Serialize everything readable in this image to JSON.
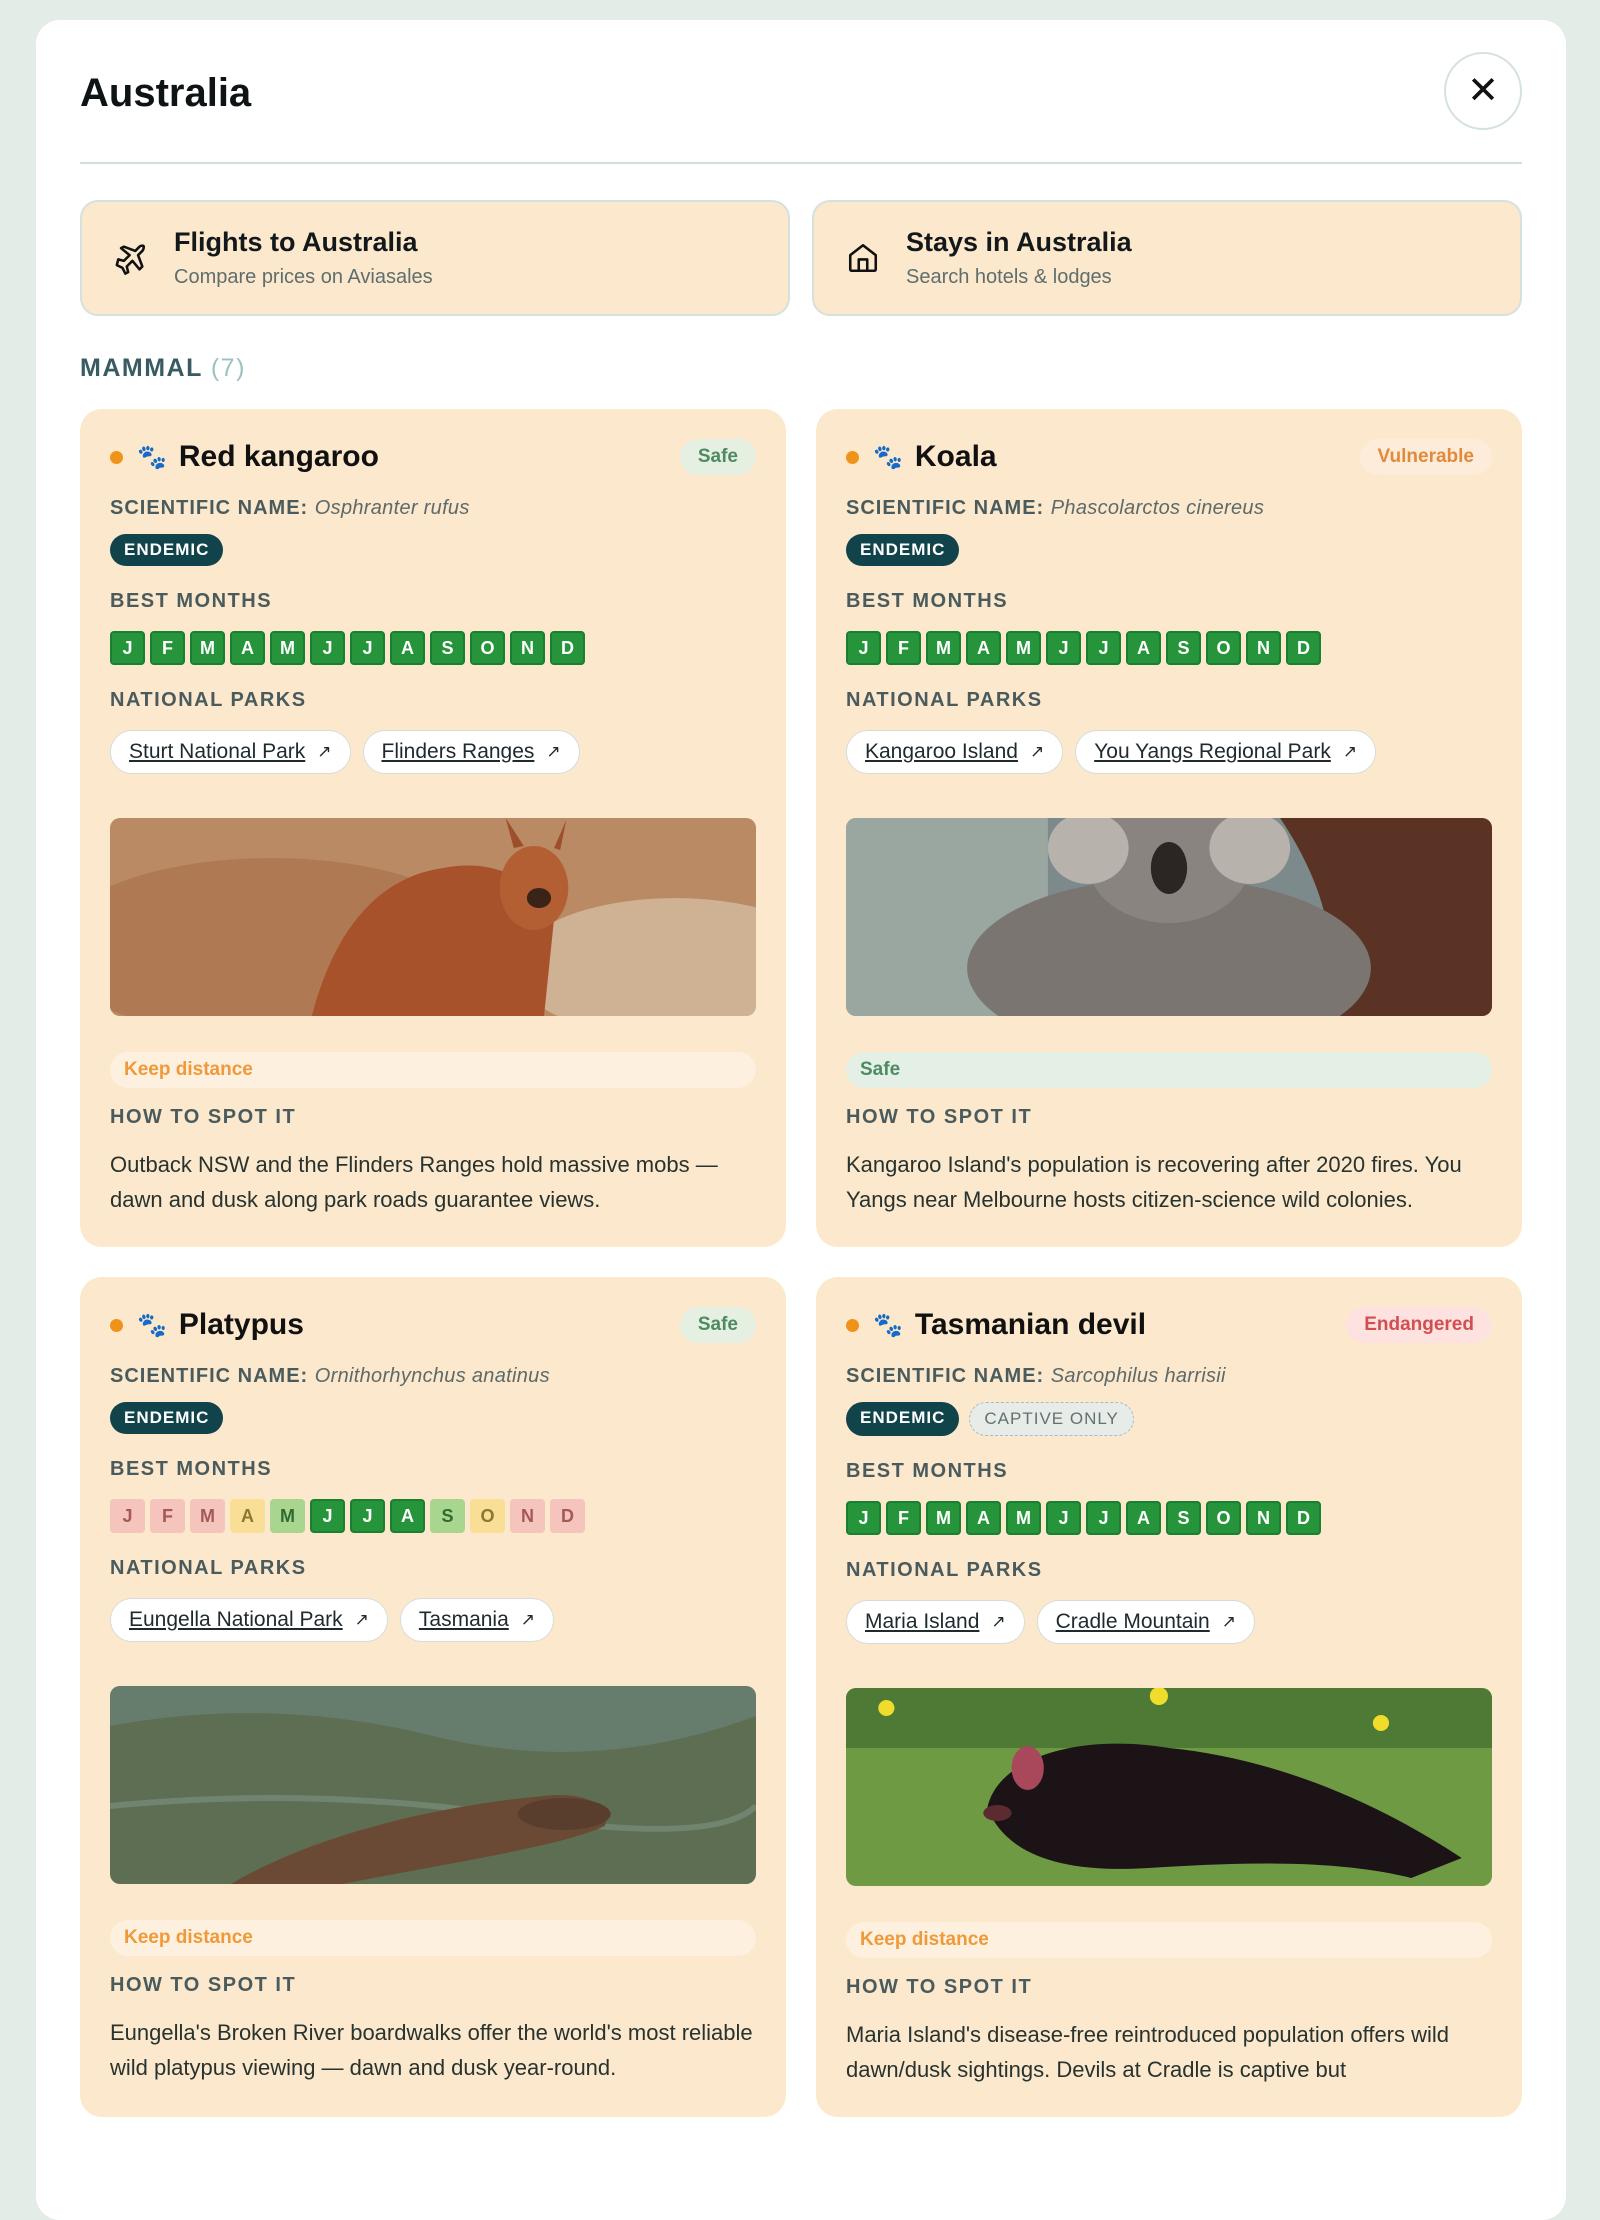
{
  "header": {
    "title": "Australia"
  },
  "cta": {
    "flights": {
      "title": "Flights to Australia",
      "subtitle": "Compare prices on Aviasales"
    },
    "stays": {
      "title": "Stays in Australia",
      "subtitle": "Search hotels & lodges"
    }
  },
  "section": {
    "label": "MAMMAL",
    "count": "(7)"
  },
  "labels": {
    "scientific": "SCIENTIFIC NAME:",
    "best_months": "BEST MONTHS",
    "national_parks": "NATIONAL PARKS",
    "how_to_spot": "HOW TO SPOT IT"
  },
  "animals": [
    {
      "name": "Red kangaroo",
      "status": "Safe",
      "scientific": "Osphranter rufus",
      "tags": [
        "ENDEMIC"
      ],
      "months": [
        {
          "l": "J",
          "q": "best"
        },
        {
          "l": "F",
          "q": "best"
        },
        {
          "l": "M",
          "q": "best"
        },
        {
          "l": "A",
          "q": "best"
        },
        {
          "l": "M",
          "q": "best"
        },
        {
          "l": "J",
          "q": "best"
        },
        {
          "l": "J",
          "q": "best"
        },
        {
          "l": "A",
          "q": "best"
        },
        {
          "l": "S",
          "q": "best"
        },
        {
          "l": "O",
          "q": "best"
        },
        {
          "l": "N",
          "q": "best"
        },
        {
          "l": "D",
          "q": "best"
        }
      ],
      "parks": [
        "Sturt National Park",
        "Flinders Ranges"
      ],
      "note": "Keep distance",
      "howto": "Outback NSW and the Flinders Ranges hold massive mobs — dawn and dusk along park roads guarantee views."
    },
    {
      "name": "Koala",
      "status": "Vulnerable",
      "scientific": "Phascolarctos cinereus",
      "tags": [
        "ENDEMIC"
      ],
      "months": [
        {
          "l": "J",
          "q": "best"
        },
        {
          "l": "F",
          "q": "best"
        },
        {
          "l": "M",
          "q": "best"
        },
        {
          "l": "A",
          "q": "best"
        },
        {
          "l": "M",
          "q": "best"
        },
        {
          "l": "J",
          "q": "best"
        },
        {
          "l": "J",
          "q": "best"
        },
        {
          "l": "A",
          "q": "best"
        },
        {
          "l": "S",
          "q": "best"
        },
        {
          "l": "O",
          "q": "best"
        },
        {
          "l": "N",
          "q": "best"
        },
        {
          "l": "D",
          "q": "best"
        }
      ],
      "parks": [
        "Kangaroo Island",
        "You Yangs Regional Park"
      ],
      "note": "Safe",
      "howto": "Kangaroo Island's population is recovering after 2020 fires. You Yangs near Melbourne hosts citizen-science wild colonies."
    },
    {
      "name": "Platypus",
      "status": "Safe",
      "scientific": "Ornithorhynchus anatinus",
      "tags": [
        "ENDEMIC"
      ],
      "months": [
        {
          "l": "J",
          "q": "poor"
        },
        {
          "l": "F",
          "q": "poor"
        },
        {
          "l": "M",
          "q": "poor"
        },
        {
          "l": "A",
          "q": "fair"
        },
        {
          "l": "M",
          "q": "good"
        },
        {
          "l": "J",
          "q": "best"
        },
        {
          "l": "J",
          "q": "best"
        },
        {
          "l": "A",
          "q": "best"
        },
        {
          "l": "S",
          "q": "good"
        },
        {
          "l": "O",
          "q": "fair"
        },
        {
          "l": "N",
          "q": "poor"
        },
        {
          "l": "D",
          "q": "poor"
        }
      ],
      "parks": [
        "Eungella National Park",
        "Tasmania"
      ],
      "note": "Keep distance",
      "howto": "Eungella's Broken River boardwalks offer the world's most reliable wild platypus viewing — dawn and dusk year-round."
    },
    {
      "name": "Tasmanian devil",
      "status": "Endangered",
      "scientific": "Sarcophilus harrisii",
      "tags": [
        "ENDEMIC",
        "CAPTIVE ONLY"
      ],
      "months": [
        {
          "l": "J",
          "q": "best"
        },
        {
          "l": "F",
          "q": "best"
        },
        {
          "l": "M",
          "q": "best"
        },
        {
          "l": "A",
          "q": "best"
        },
        {
          "l": "M",
          "q": "best"
        },
        {
          "l": "J",
          "q": "best"
        },
        {
          "l": "J",
          "q": "best"
        },
        {
          "l": "A",
          "q": "best"
        },
        {
          "l": "S",
          "q": "best"
        },
        {
          "l": "O",
          "q": "best"
        },
        {
          "l": "N",
          "q": "best"
        },
        {
          "l": "D",
          "q": "best"
        }
      ],
      "parks": [
        "Maria Island",
        "Cradle Mountain"
      ],
      "note": "Keep distance",
      "howto": "Maria Island's disease-free reintroduced population offers wild dawn/dusk sightings. Devils at Cradle is captive but"
    }
  ],
  "icons": {
    "close": "close-icon",
    "flights": "plane-icon",
    "stays": "house-icon",
    "animal": "paw-icon",
    "park_link": "external-link-icon"
  },
  "colors": {
    "card_bg": "#fbe8cd",
    "endemic_tag": "#10434a",
    "best_month": "#25943a",
    "accent_dot": "#f0931a"
  }
}
